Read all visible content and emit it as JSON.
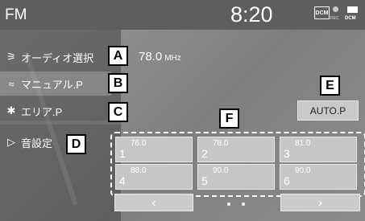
{
  "status_bar": {
    "title": "FM",
    "time": "8:20",
    "dcm_badge": "DCM",
    "rec_label": "REC",
    "dcm_label": "DCM"
  },
  "menu": {
    "items": [
      {
        "icon": "source-select-icon",
        "label": "オーディオ選択"
      },
      {
        "icon": "manual-tune-icon",
        "label": "マニュアル.P"
      },
      {
        "icon": "area-antenna-icon",
        "label": "エリア.P"
      },
      {
        "icon": "speaker-icon",
        "label": "音設定"
      }
    ]
  },
  "frequency": {
    "value": "78.0",
    "unit": "MHz"
  },
  "auto_preset_label": "AUTO.P",
  "callouts": {
    "a": "A",
    "b": "B",
    "c": "C",
    "d": "D",
    "e": "E",
    "f": "F"
  },
  "presets": [
    {
      "number": "1",
      "freq": "76.0"
    },
    {
      "number": "2",
      "freq": "78.0"
    },
    {
      "number": "3",
      "freq": "81.0"
    },
    {
      "number": "4",
      "freq": "88.0"
    },
    {
      "number": "5",
      "freq": "90.0"
    },
    {
      "number": "6",
      "freq": "90.0"
    }
  ],
  "nav": {
    "prev": "‹",
    "next": "›"
  }
}
